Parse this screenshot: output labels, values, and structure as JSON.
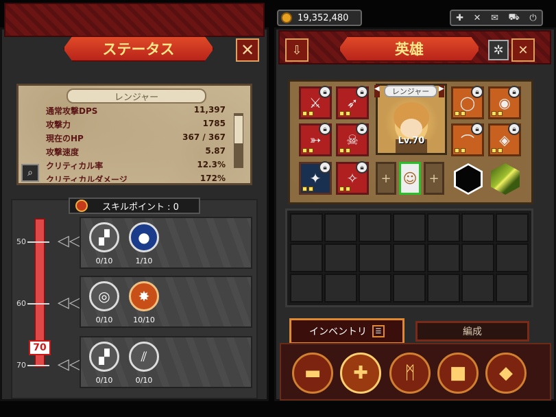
{
  "left_panel": {
    "title": "ステータス",
    "close_icon": "✕",
    "character_name": "レンジャー",
    "stats": [
      {
        "label": "通常攻撃DPS",
        "value": "11,397"
      },
      {
        "label": "攻撃力",
        "value": "1785"
      },
      {
        "label": "現在のHP",
        "value": "367 / 367"
      },
      {
        "label": "攻撃速度",
        "value": "5.87"
      },
      {
        "label": "クリティカル率",
        "value": "12.3%"
      },
      {
        "label": "クリティカルダメージ",
        "value": "172%"
      }
    ],
    "skill_points_label": "スキルポイント : 0",
    "level_marks": [
      "50",
      "60",
      "70"
    ],
    "current_level": "70",
    "skill_rows": [
      {
        "skills": [
          {
            "count": "0/10",
            "icon": "boot-icon"
          },
          {
            "count": "1/10",
            "icon": "blue-orb-icon"
          }
        ]
      },
      {
        "skills": [
          {
            "count": "0/10",
            "icon": "swirl-icon"
          },
          {
            "count": "10/10",
            "icon": "fire-slash-icon"
          }
        ]
      },
      {
        "skills": [
          {
            "count": "0/10",
            "icon": "boot-icon"
          },
          {
            "count": "0/10",
            "icon": "claw-slash-icon"
          }
        ]
      }
    ]
  },
  "right_panel": {
    "gold": "19,352,480",
    "title": "英雄",
    "close_icon": "✕",
    "portrait_name": "レンジャー",
    "portrait_level": "Lv.70",
    "inventory_tab": "インベントリ",
    "formation_tab": "編成",
    "empty_slot": "+",
    "menu": [
      {
        "name": "chest-icon",
        "glyph": "▬"
      },
      {
        "name": "cross-icon",
        "glyph": "✚"
      },
      {
        "name": "rune-icon",
        "glyph": "ᛗ"
      },
      {
        "name": "box-icon",
        "glyph": "■"
      },
      {
        "name": "gem-icon",
        "glyph": "◆"
      }
    ]
  },
  "colors": {
    "accent_red": "#b8241a",
    "title_text": "#ffe88a",
    "level_bar": "#e04848",
    "parchment": "#cdbb98"
  }
}
